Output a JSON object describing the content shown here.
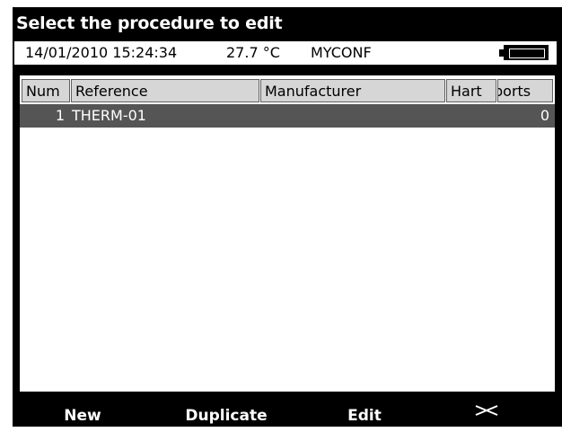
{
  "window": {
    "title": "Select the procedure to edit"
  },
  "status": {
    "datetime": "14/01/2010 15:24:34",
    "temperature": "27.7 °C",
    "config": "MYCONF",
    "battery_icon": "battery-icon"
  },
  "table": {
    "columns": [
      "Num",
      "Reference",
      "Manufacturer",
      "Hart",
      "ports"
    ],
    "rows": [
      {
        "num": "1",
        "reference": "THERM-01",
        "manufacturer": "",
        "hart": "",
        "ports": "0"
      }
    ]
  },
  "softkeys": {
    "new": "New",
    "duplicate": "Duplicate",
    "edit": "Edit",
    "close_icon": "close-icon"
  },
  "colors": {
    "frame": "#000000",
    "selected_row": "#555555",
    "header_cell": "#d6d6d6"
  }
}
